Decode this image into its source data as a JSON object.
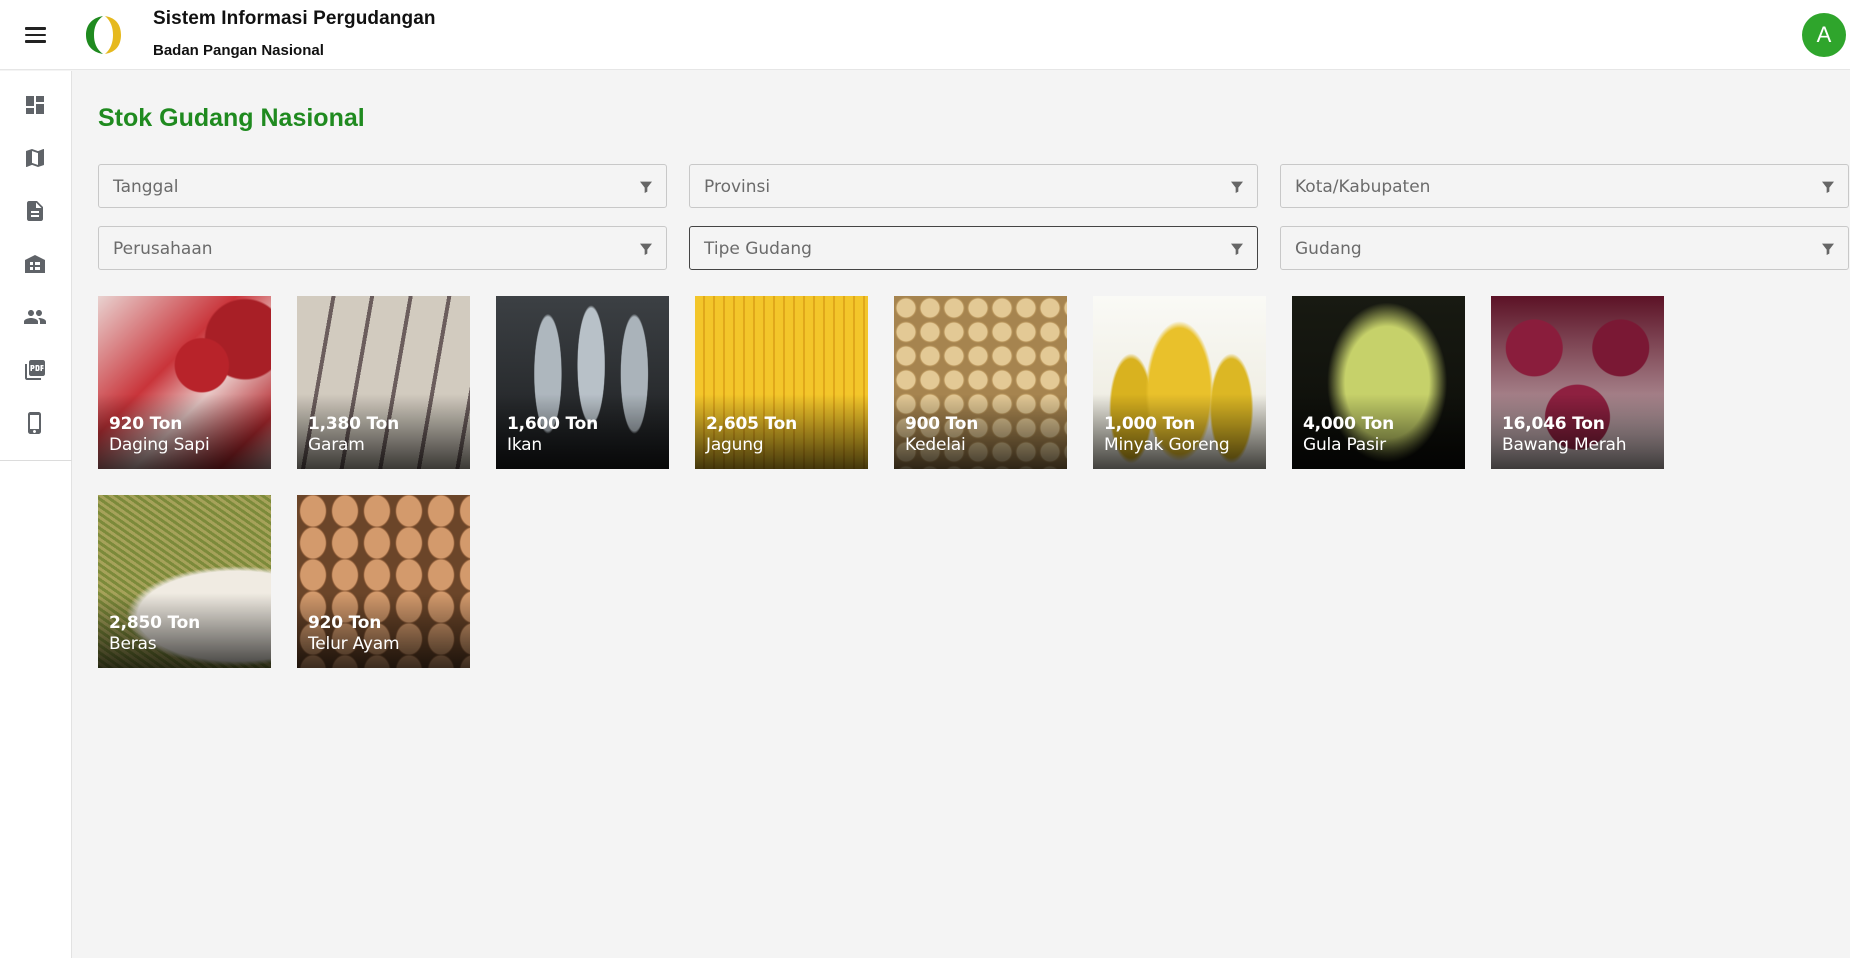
{
  "header": {
    "title": "Sistem Informasi Pergudangan",
    "subtitle": "Badan Pangan Nasional",
    "avatar_initial": "A",
    "menu_icon": "hamburger-menu-icon",
    "logo_colors": {
      "green": "#1f8a1f",
      "yellow": "#e6b91e"
    }
  },
  "sidebar": {
    "items": [
      {
        "icon": "dashboard-icon"
      },
      {
        "icon": "map-icon"
      },
      {
        "icon": "document-icon"
      },
      {
        "icon": "warehouse-icon"
      },
      {
        "icon": "people-icon"
      },
      {
        "icon": "pdf-icon"
      },
      {
        "icon": "mobile-phone-icon"
      }
    ]
  },
  "main": {
    "title": "Stok Gudang Nasional",
    "filters": [
      {
        "label": "Tanggal"
      },
      {
        "label": "Provinsi"
      },
      {
        "label": "Kota/Kabupaten"
      },
      {
        "label": "Perusahaan"
      },
      {
        "label": "Tipe Gudang"
      },
      {
        "label": "Gudang"
      }
    ],
    "commodities": [
      {
        "qty": "920 Ton",
        "name": "Daging Sapi"
      },
      {
        "qty": "1,380 Ton",
        "name": "Garam"
      },
      {
        "qty": "1,600 Ton",
        "name": "Ikan"
      },
      {
        "qty": "2,605 Ton",
        "name": "Jagung"
      },
      {
        "qty": "900 Ton",
        "name": "Kedelai"
      },
      {
        "qty": "1,000 Ton",
        "name": "Minyak Goreng"
      },
      {
        "qty": "4,000 Ton",
        "name": "Gula Pasir"
      },
      {
        "qty": "16,046 Ton",
        "name": "Bawang Merah"
      },
      {
        "qty": "2,850 Ton",
        "name": "Beras"
      },
      {
        "qty": "920 Ton",
        "name": "Telur Ayam"
      }
    ]
  },
  "colors": {
    "accent": "#1f8a1f",
    "avatar": "#2fa52c"
  }
}
